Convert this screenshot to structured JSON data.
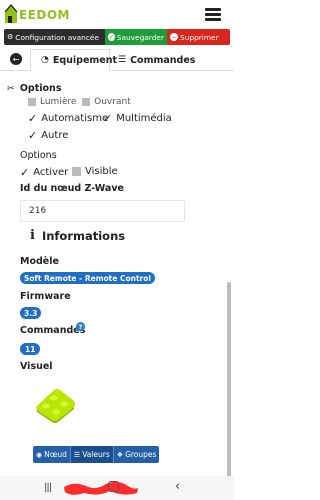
{
  "app": {
    "logo_text": "EEDOM"
  },
  "actions": {
    "config_label": "Configuration avancée",
    "save_label": "Sauvegarder",
    "delete_label": "Supprimer"
  },
  "tabs": {
    "equipment_label": "Equipement",
    "commands_label": "Commandes"
  },
  "options": {
    "heading": "Options",
    "partial_categories": [
      "Lumière",
      "Ouvrant"
    ],
    "categories": [
      {
        "label": "Automatisme",
        "checked": true
      },
      {
        "label": "Multimédia",
        "checked": true
      },
      {
        "label": "Autre",
        "checked": true
      }
    ],
    "options_label": "Options",
    "activer_label": "Activer",
    "activer_checked": true,
    "visible_label": "Visible",
    "visible_checked": false
  },
  "zwave": {
    "label": "Id du nœud Z-Wave",
    "value": "216"
  },
  "informations": {
    "heading": "Informations",
    "model_label": "Modèle",
    "model_value": "Soft Remote - Remote Control",
    "firmware_label": "Firmware",
    "firmware_value": "3.3",
    "commands_label": "Commandes",
    "commands_help": "?",
    "commands_value": "11",
    "visual_label": "Visuel"
  },
  "bottom_buttons": [
    {
      "label": "Nœud",
      "icon": "globe-icon",
      "active": false
    },
    {
      "label": "Valeurs",
      "icon": "list-icon",
      "active": true
    },
    {
      "label": "Groupes",
      "icon": "layers-icon",
      "active": false
    }
  ],
  "colors": {
    "brand_green": "#94c11f",
    "save_green": "#1f9d3a",
    "delete_red": "#d9271e",
    "badge_blue": "#1f6fc7"
  }
}
